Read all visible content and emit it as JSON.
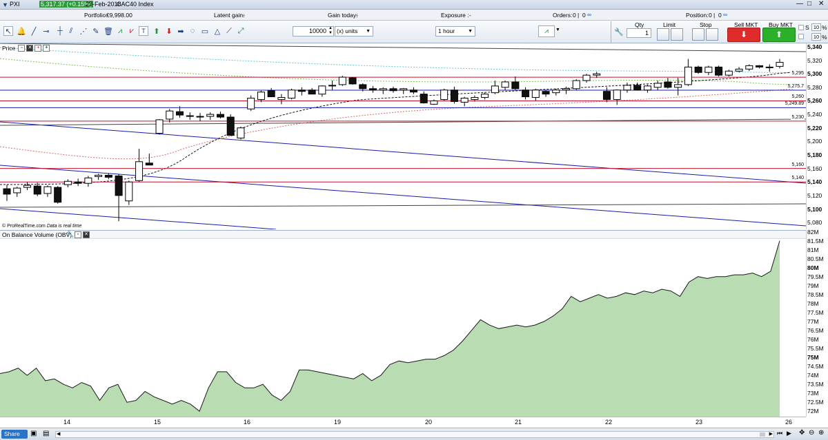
{
  "titlebar": {
    "app": "PXI",
    "quote": "5,317.37 (+0.15%)",
    "date": "23-Feb-2018",
    "instrument": "CAC40 Index"
  },
  "infobar": {
    "portfolio_label": "Portfolio:",
    "portfolio_value": "€9,998.00",
    "latent_label": "Latent gain:",
    "latent_value": "-",
    "gain_today_label": "Gain today:",
    "gain_today_value": "-",
    "exposure_label": "Exposure :",
    "exposure_value": "-",
    "orders_label": "Orders:",
    "orders_a": "0",
    "orders_b": "0",
    "position_label": "Position:",
    "position_a": "0",
    "position_b": "0"
  },
  "toolbar": {
    "quantity_value": "10000",
    "units_select": "(x) units",
    "timeframe_select": "1 hour",
    "qty_label": "Qty",
    "qty_value": "1",
    "limit_label": "Limit",
    "stop_label": "Stop",
    "sell_label": "Sell MKT",
    "buy_label": "Buy MKT",
    "s_label": "S",
    "s_value": "10",
    "l_value": "10",
    "pct": "%"
  },
  "price_pane": {
    "title": "Price",
    "credit": "© ProRealTime.com",
    "realtime_note": "Data is real time"
  },
  "obv_pane": {
    "title": "On Balance Volume (OBV)"
  },
  "price_axis": [
    "5,340",
    "5,320",
    "5,300",
    "5,280",
    "5,260",
    "5,240",
    "5,220",
    "5,200",
    "5,180",
    "5,160",
    "5,140",
    "5,120",
    "5,100",
    "5,080"
  ],
  "price_marks": [
    "5,295",
    "5,275.7",
    "5,260",
    "5,249.89",
    "5,230",
    "5,160",
    "5,140"
  ],
  "obv_axis": [
    "82M",
    "81.5M",
    "81M",
    "80.5M",
    "80M",
    "79.5M",
    "79M",
    "78.5M",
    "78M",
    "77.5M",
    "77M",
    "76.5M",
    "76M",
    "75.5M",
    "75M",
    "74.5M",
    "74M",
    "73.5M",
    "73M",
    "72.5M",
    "72M"
  ],
  "date_axis": [
    "14",
    "15",
    "16",
    "19",
    "20",
    "21",
    "22",
    "23",
    "26"
  ],
  "statusbar": {
    "share_label": "Share"
  },
  "colors": {
    "obv_fill": "#b9dcb3",
    "obv_line": "#1a1a1a",
    "support_red": "#c8102e",
    "support_blue": "#1a1aa8",
    "sell": "#e02b2b",
    "buy": "#2bb02b",
    "quote_badge": "#2a9d3a"
  },
  "chart_data": {
    "type": "candlestick",
    "instrument": "CAC40 Index",
    "timeframe": "1 hour",
    "price_range": [
      5070,
      5345
    ],
    "obv_range": [
      71.7,
      82.1
    ],
    "candles": [
      {
        "o": 5130,
        "h": 5136,
        "l": 5112,
        "c": 5122
      },
      {
        "o": 5124,
        "h": 5133,
        "l": 5118,
        "c": 5131
      },
      {
        "o": 5132,
        "h": 5140,
        "l": 5128,
        "c": 5135
      },
      {
        "o": 5134,
        "h": 5139,
        "l": 5119,
        "c": 5122
      },
      {
        "o": 5123,
        "h": 5135,
        "l": 5118,
        "c": 5133
      },
      {
        "o": 5132,
        "h": 5134,
        "l": 5108,
        "c": 5110
      },
      {
        "o": 5136,
        "h": 5144,
        "l": 5132,
        "c": 5141
      },
      {
        "o": 5140,
        "h": 5145,
        "l": 5134,
        "c": 5138
      },
      {
        "o": 5138,
        "h": 5149,
        "l": 5133,
        "c": 5146
      },
      {
        "o": 5148,
        "h": 5152,
        "l": 5143,
        "c": 5150
      },
      {
        "o": 5150,
        "h": 5153,
        "l": 5144,
        "c": 5147
      },
      {
        "o": 5149,
        "h": 5152,
        "l": 5082,
        "c": 5120
      },
      {
        "o": 5112,
        "h": 5142,
        "l": 5106,
        "c": 5140
      },
      {
        "o": 5142,
        "h": 5189,
        "l": 5140,
        "c": 5170
      },
      {
        "o": 5168,
        "h": 5182,
        "l": 5165,
        "c": 5165
      },
      {
        "o": 5212,
        "h": 5233,
        "l": 5210,
        "c": 5232
      },
      {
        "o": 5233,
        "h": 5248,
        "l": 5228,
        "c": 5245
      },
      {
        "o": 5244,
        "h": 5252,
        "l": 5235,
        "c": 5239
      },
      {
        "o": 5238,
        "h": 5243,
        "l": 5232,
        "c": 5237
      },
      {
        "o": 5237,
        "h": 5242,
        "l": 5230,
        "c": 5236
      },
      {
        "o": 5237,
        "h": 5243,
        "l": 5232,
        "c": 5240
      },
      {
        "o": 5240,
        "h": 5244,
        "l": 5234,
        "c": 5236
      },
      {
        "o": 5236,
        "h": 5240,
        "l": 5208,
        "c": 5209
      },
      {
        "o": 5205,
        "h": 5222,
        "l": 5203,
        "c": 5220
      },
      {
        "o": 5248,
        "h": 5268,
        "l": 5245,
        "c": 5264
      },
      {
        "o": 5262,
        "h": 5275,
        "l": 5258,
        "c": 5273
      },
      {
        "o": 5275,
        "h": 5279,
        "l": 5266,
        "c": 5266
      },
      {
        "o": 5262,
        "h": 5270,
        "l": 5255,
        "c": 5265
      },
      {
        "o": 5264,
        "h": 5278,
        "l": 5262,
        "c": 5276
      },
      {
        "o": 5276,
        "h": 5280,
        "l": 5268,
        "c": 5274
      },
      {
        "o": 5276,
        "h": 5279,
        "l": 5270,
        "c": 5270
      },
      {
        "o": 5270,
        "h": 5283,
        "l": 5266,
        "c": 5282
      },
      {
        "o": 5282,
        "h": 5290,
        "l": 5276,
        "c": 5283
      },
      {
        "o": 5284,
        "h": 5297,
        "l": 5282,
        "c": 5295
      },
      {
        "o": 5294,
        "h": 5295,
        "l": 5284,
        "c": 5285
      },
      {
        "o": 5284,
        "h": 5286,
        "l": 5274,
        "c": 5278
      },
      {
        "o": 5278,
        "h": 5282,
        "l": 5272,
        "c": 5276
      },
      {
        "o": 5276,
        "h": 5280,
        "l": 5270,
        "c": 5278
      },
      {
        "o": 5278,
        "h": 5281,
        "l": 5272,
        "c": 5275
      },
      {
        "o": 5276,
        "h": 5279,
        "l": 5270,
        "c": 5278
      },
      {
        "o": 5276,
        "h": 5280,
        "l": 5270,
        "c": 5273
      },
      {
        "o": 5270,
        "h": 5274,
        "l": 5256,
        "c": 5257
      },
      {
        "o": 5255,
        "h": 5262,
        "l": 5254,
        "c": 5260
      },
      {
        "o": 5262,
        "h": 5278,
        "l": 5260,
        "c": 5276
      },
      {
        "o": 5276,
        "h": 5281,
        "l": 5256,
        "c": 5259
      },
      {
        "o": 5258,
        "h": 5266,
        "l": 5252,
        "c": 5264
      },
      {
        "o": 5262,
        "h": 5268,
        "l": 5259,
        "c": 5265
      },
      {
        "o": 5265,
        "h": 5272,
        "l": 5262,
        "c": 5270
      },
      {
        "o": 5272,
        "h": 5290,
        "l": 5270,
        "c": 5282
      },
      {
        "o": 5280,
        "h": 5290,
        "l": 5276,
        "c": 5288
      },
      {
        "o": 5288,
        "h": 5296,
        "l": 5276,
        "c": 5278
      },
      {
        "o": 5276,
        "h": 5280,
        "l": 5262,
        "c": 5266
      },
      {
        "o": 5265,
        "h": 5278,
        "l": 5260,
        "c": 5276
      },
      {
        "o": 5274,
        "h": 5276,
        "l": 5266,
        "c": 5270
      },
      {
        "o": 5272,
        "h": 5278,
        "l": 5268,
        "c": 5276
      },
      {
        "o": 5276,
        "h": 5281,
        "l": 5270,
        "c": 5278
      },
      {
        "o": 5278,
        "h": 5292,
        "l": 5276,
        "c": 5290
      },
      {
        "o": 5290,
        "h": 5300,
        "l": 5287,
        "c": 5298
      },
      {
        "o": 5298,
        "h": 5303,
        "l": 5294,
        "c": 5300
      },
      {
        "o": 5274,
        "h": 5280,
        "l": 5258,
        "c": 5262
      },
      {
        "o": 5262,
        "h": 5277,
        "l": 5254,
        "c": 5276
      },
      {
        "o": 5276,
        "h": 5287,
        "l": 5272,
        "c": 5283
      },
      {
        "o": 5283,
        "h": 5287,
        "l": 5275,
        "c": 5276
      },
      {
        "o": 5276,
        "h": 5284,
        "l": 5272,
        "c": 5282
      },
      {
        "o": 5280,
        "h": 5290,
        "l": 5276,
        "c": 5286
      },
      {
        "o": 5288,
        "h": 5294,
        "l": 5278,
        "c": 5280
      },
      {
        "o": 5280,
        "h": 5294,
        "l": 5268,
        "c": 5284
      },
      {
        "o": 5284,
        "h": 5322,
        "l": 5282,
        "c": 5310
      },
      {
        "o": 5310,
        "h": 5312,
        "l": 5300,
        "c": 5302
      },
      {
        "o": 5302,
        "h": 5312,
        "l": 5298,
        "c": 5310
      },
      {
        "o": 5310,
        "h": 5312,
        "l": 5296,
        "c": 5298
      },
      {
        "o": 5298,
        "h": 5306,
        "l": 5296,
        "c": 5304
      },
      {
        "o": 5304,
        "h": 5310,
        "l": 5302,
        "c": 5307
      },
      {
        "o": 5307,
        "h": 5314,
        "l": 5304,
        "c": 5312
      },
      {
        "o": 5312,
        "h": 5313,
        "l": 5308,
        "c": 5310
      },
      {
        "o": 5310,
        "h": 5314,
        "l": 5303,
        "c": 5310
      },
      {
        "o": 5311,
        "h": 5322,
        "l": 5308,
        "c": 5317
      }
    ],
    "obv": [
      74.1,
      74.2,
      74.4,
      74.0,
      74.4,
      73.7,
      73.8,
      73.5,
      73.3,
      73.6,
      73.4,
      72.6,
      73.3,
      73.5,
      72.5,
      72.6,
      73.1,
      72.8,
      72.6,
      72.4,
      72.6,
      72.4,
      72.0,
      73.3,
      74.2,
      74.2,
      73.6,
      73.3,
      73.3,
      73.5,
      72.9,
      72.6,
      73.1,
      74.3,
      74.3,
      74.2,
      74.1,
      74.0,
      73.9,
      73.8,
      74.1,
      73.7,
      74.0,
      74.6,
      74.8,
      74.7,
      74.8,
      74.9,
      74.9,
      75.1,
      75.4,
      75.9,
      76.5,
      77.1,
      76.8,
      76.6,
      76.7,
      76.8,
      76.7,
      76.8,
      77.0,
      77.3,
      77.7,
      78.4,
      78.1,
      78.3,
      78.5,
      78.3,
      78.4,
      78.6,
      78.5,
      78.7,
      78.6,
      78.8,
      78.7,
      78.4,
      79.2,
      79.5,
      79.4,
      79.5,
      79.5,
      79.6,
      79.6,
      79.7,
      79.5,
      79.8,
      81.5
    ],
    "horizontal_levels": [
      {
        "value": 5295,
        "color": "red"
      },
      {
        "value": 5275.7,
        "color": "blue"
      },
      {
        "value": 5260,
        "color": "red"
      },
      {
        "value": 5249.89,
        "color": "blue"
      },
      {
        "value": 5230,
        "color": "red"
      },
      {
        "value": 5160,
        "color": "red"
      },
      {
        "value": 5140,
        "color": "red"
      }
    ]
  }
}
